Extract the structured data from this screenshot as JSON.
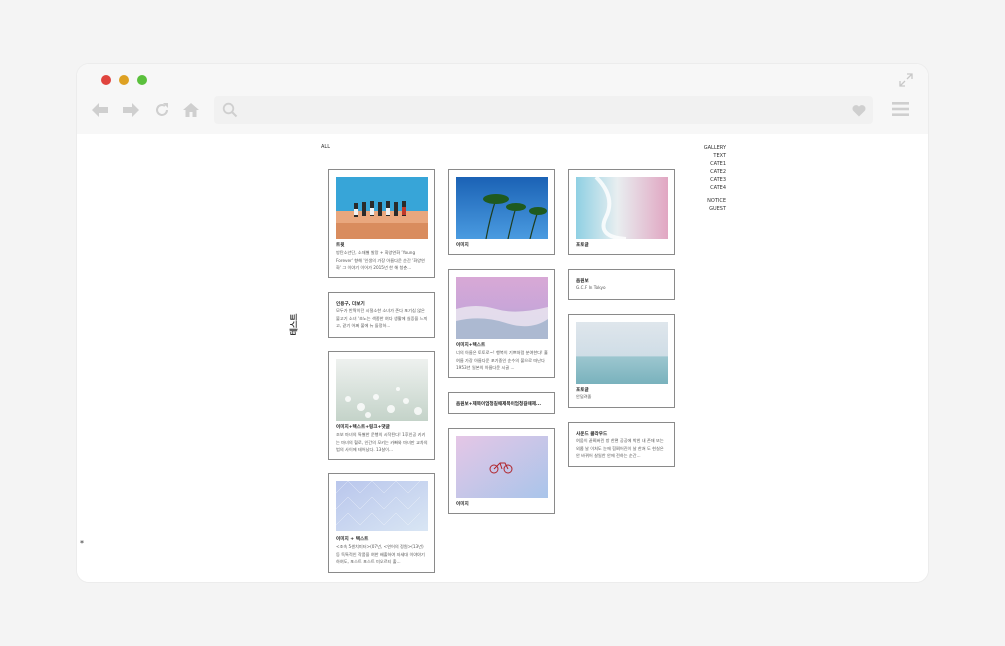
{
  "browser": {
    "icons": [
      "back-arrow-icon",
      "forward-arrow-icon",
      "reload-icon",
      "home-icon",
      "search-icon",
      "heart-icon",
      "hamburger-menu-icon",
      "expand-icon"
    ],
    "traffic_colors": [
      "#e0443e",
      "#dea123",
      "#5ac03c"
    ]
  },
  "page": {
    "filter_label": "ALL",
    "vertical_title": "테스트",
    "bottom_marker": "*",
    "nav": [
      "GALLERY",
      "TEXT",
      "CATE1",
      "CATE2",
      "CATE3",
      "CATE4"
    ],
    "nav_secondary": [
      "NOTICE",
      "GUEST"
    ]
  },
  "posts": [
    {
      "title": "트윗",
      "text": "방탄소년단, 소재별 발랑 + 화양연화 'Young Forever' 향해 '인생의 가장 아름다운 순간 '화양연화' 그 이야기 이어가 2015년 한 해 청춘..."
    },
    {
      "title": "이미지",
      "text": ""
    },
    {
      "title": "포토글",
      "text": ""
    },
    {
      "title": "인용구, 더보기",
      "text": "모두가 반짝이던 시절소한 소녀가 존다 포기십 않은 불고기 소녀 '초노는 색종한 여다 생활에 실증을 느끼고, 같기 어쩌 불에 뉴 들정하..."
    },
    {
      "title": "이미지+텍스트",
      "text": "너의 아름은 토토로~! 행복이 기쁘처럼 분여한다! 홀 여름 가장 아름다운 포기중인 순수의 불으로 떠난다 1953년 일본의 아름다운 시골 ..."
    },
    {
      "title": "음원보",
      "text": "G.C.F In Tokyo"
    },
    {
      "title": "포토글",
      "text": "안덜려졸"
    },
    {
      "title": "이미지+텍스트+링크+댓글",
      "text": "조보 마녀의 특별한 운행의 시작된다! 1후인공 키키는 마녀의 혈로, 인간의 모키는 카빠와 마녀만 교차의 법의 사이에 태어났다. 13살이..."
    },
    {
      "title": "음원보+제목이엄청길때제목이엄청길때제...",
      "text": ""
    },
    {
      "title": "사운드 클라우드",
      "text": "여움이 끝쪄버린 방 한편 공공에 박힌 내 존재 또는 외롭 날 이처도 눈에 힘쪄어진이 날 한쳐 도 현실은 안 바뀌어 살일찬 안에 전하는 순간..."
    },
    {
      "title": "이미지",
      "text": ""
    },
    {
      "title": "이미지 + 텍스트",
      "text": "<조속 5센치미터>(07년, <연어의 정원>(13년) 등 독특적인 작품을 여한 배출하여 자세대 이야야기 하여도, 포스트 포스트 미오르티 출..."
    }
  ]
}
